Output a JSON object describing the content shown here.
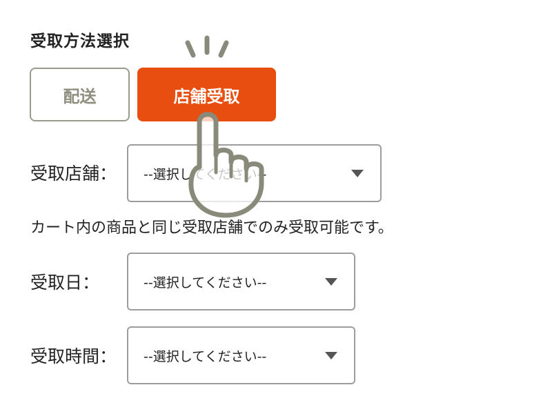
{
  "section": {
    "title": "受取方法選択"
  },
  "method_buttons": {
    "delivery_label": "配送",
    "store_label": "店舗受取",
    "selected": "店舗受取"
  },
  "fields": {
    "store": {
      "label": "受取店舗：",
      "value": "--選択してください--"
    },
    "date": {
      "label": "受取日：",
      "value": "--選択してください--"
    },
    "time": {
      "label": "受取時間：",
      "value": "--選択してください--"
    }
  },
  "note": "カート内の商品と同じ受取店舗でのみ受取可能です。",
  "icons": {
    "pointer": "hand-pointer-icon",
    "dropdown": "chevron-down-icon"
  },
  "colors": {
    "accent": "#e84e0f",
    "inactive_border": "#9a9a8c",
    "hand_stroke": "#8a8a7a"
  }
}
